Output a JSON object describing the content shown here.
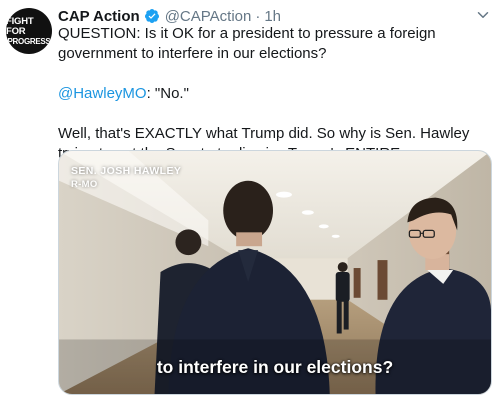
{
  "author": {
    "avatar_line1": "FIGHT FOR",
    "avatar_line2": "PROGRESS",
    "name": "CAP Action",
    "handle": "@CAPAction",
    "separator": "·",
    "time": "1h",
    "verified_icon": "verified-badge-icon",
    "verified_color": "#1da1f2"
  },
  "tweet": {
    "line1": "QUESTION: Is it OK for a president to pressure a foreign government to interfere in our elections?",
    "mention": "@HawleyMO",
    "mention_rest": ": \"No.\"",
    "line3": "Well, that's EXACTLY what Trump did. So why is Sen. Hawley trying to get the Senate to dismiss Trump's ENTIRE impeachment case?",
    "mention_color": "#1b95e0"
  },
  "video": {
    "lower_third_name": "SEN. JOSH HAWLEY",
    "lower_third_sub": "R-MO",
    "caption": "to interfere in our elections?"
  },
  "icons": {
    "more": "chevron-down-icon"
  }
}
